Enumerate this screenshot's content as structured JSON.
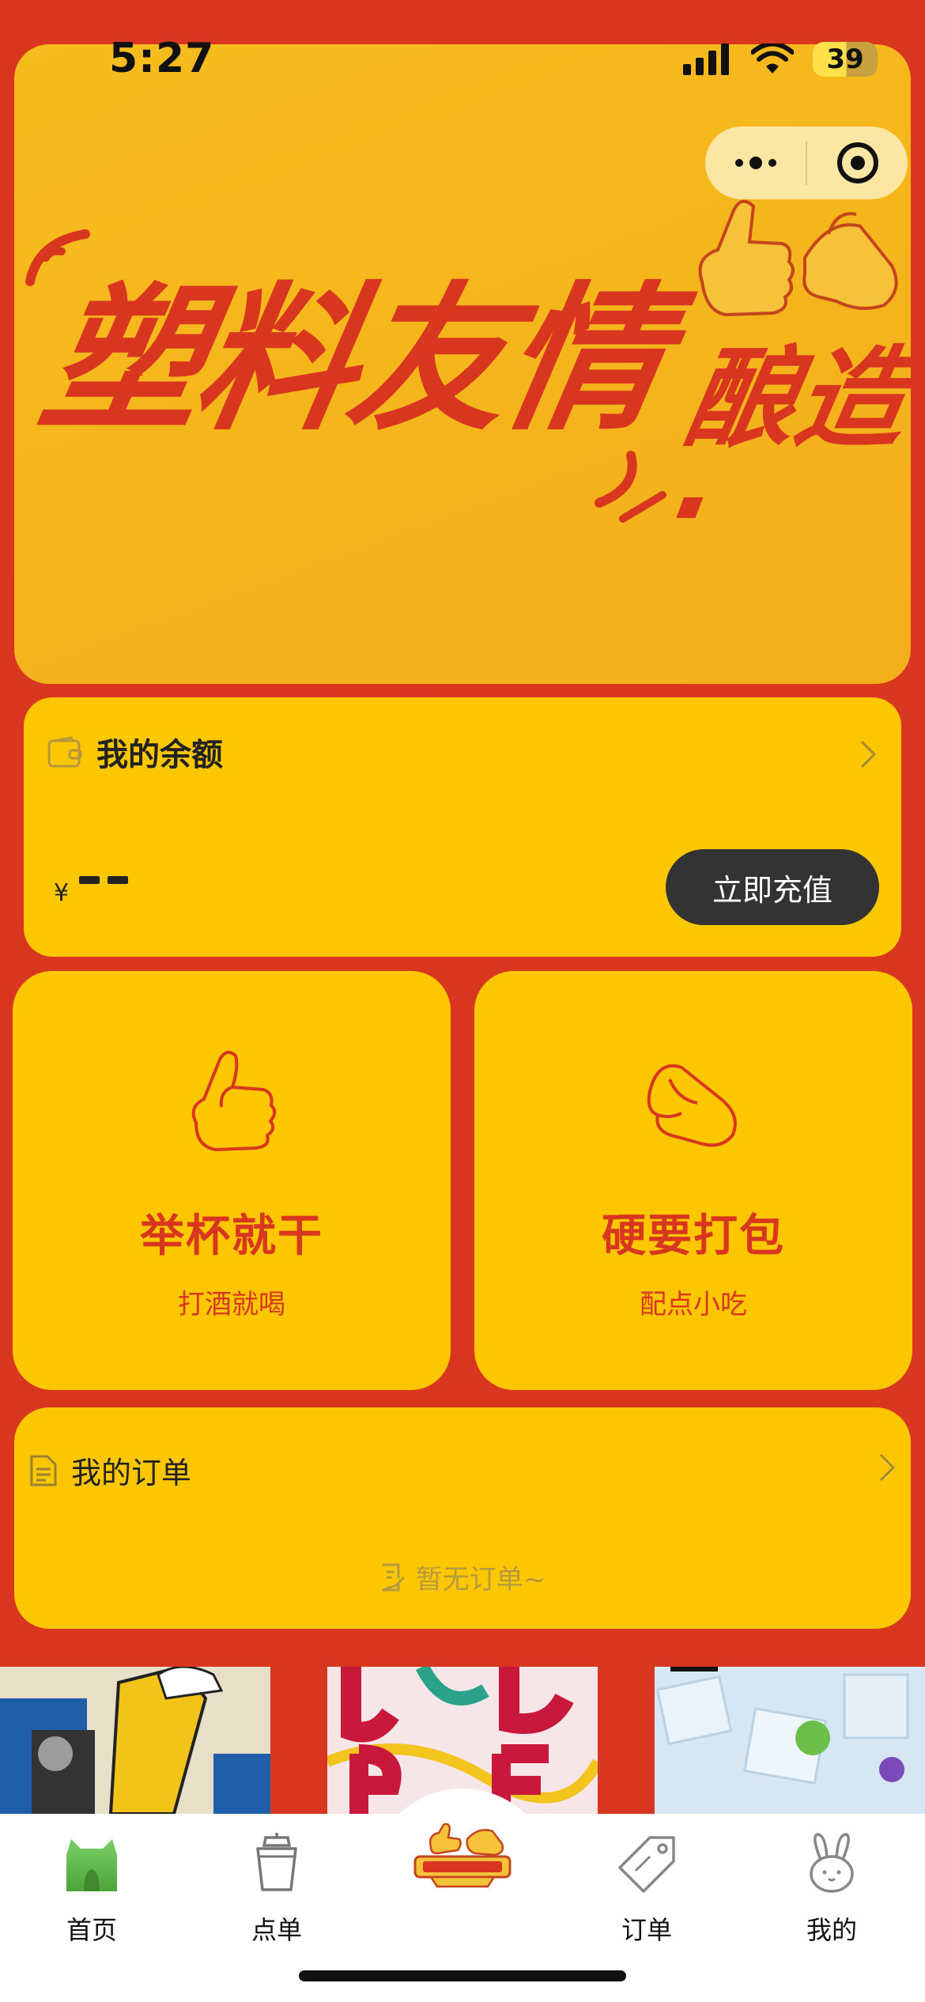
{
  "status_bar": {
    "time": "5:27",
    "battery": "39"
  },
  "banner": {
    "slogan_main": "塑料友情",
    "slogan_side": "酿造·",
    "page_count": 2,
    "active_page": 1
  },
  "balance": {
    "title": "我的余额",
    "currency": "¥",
    "recharge_label": "立即充值"
  },
  "actions": [
    {
      "title": "举杯就干",
      "subtitle": "打酒就喝",
      "icon": "thumbs-up-icon"
    },
    {
      "title": "硬要打包",
      "subtitle": "配点小吃",
      "icon": "ok-hand-icon"
    }
  ],
  "orders": {
    "title": "我的订单",
    "empty_text": "暂无订单~"
  },
  "tabbar": {
    "items": [
      {
        "label": "首页",
        "icon": "home-icon"
      },
      {
        "label": "点单",
        "icon": "cup-icon"
      },
      {
        "label": "",
        "icon": "brand-logo-icon"
      },
      {
        "label": "订单",
        "icon": "tag-icon"
      },
      {
        "label": "我的",
        "icon": "rabbit-icon"
      }
    ]
  },
  "colors": {
    "background": "#D8361F",
    "card": "#FDC700",
    "accent_red": "#D8361F",
    "dark_button": "#333333"
  }
}
